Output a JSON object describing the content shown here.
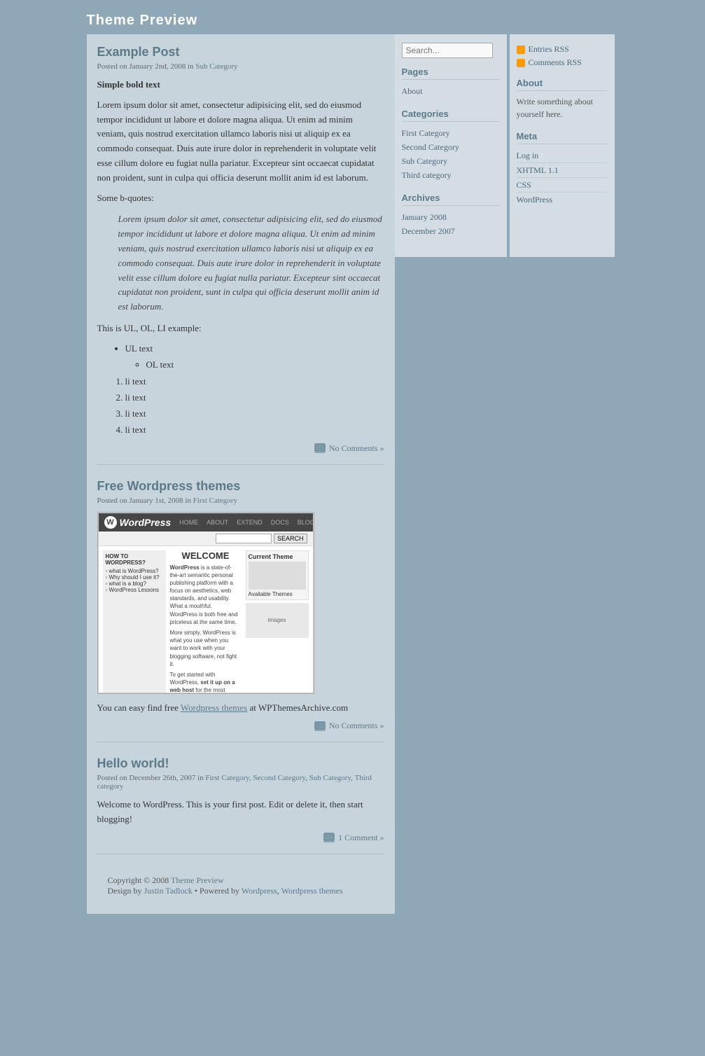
{
  "site": {
    "title": "Theme Preview"
  },
  "posts": [
    {
      "id": "post-1",
      "title": "Example Post",
      "meta": "Posted on January 2nd, 2008 in",
      "category": "Sub Category",
      "bold_heading": "Simple bold text",
      "lorem_paragraph": "Lorem ipsum dolor sit amet, consectetur adipisicing elit, sed do eiusmod tempor incididunt ut labore et dolore magna aliqua. Ut enim ad minim veniam, quis nostrud exercitation ullamco laboris nisi ut aliquip ex ea commodo consequat. Duis aute irure dolor in reprehenderit in voluptate velit esse cillum dolore eu fugiat nulla pariatur. Excepteur sint occaecat cupidatat non proident, sunt in culpa qui officia deserunt mollit anim id est laborum.",
      "bquotes_heading": "Some b-quotes:",
      "blockquote": "Lorem ipsum dolor sit amet, consectetur adipisicing elit, sed do eiusmod tempor incididunt ut labore et dolore magna aliqua. Ut enim ad minim veniam, quis nostrud exercitation ullamco laboris nisi ut aliquip ex ea commodo consequat. Duis aute irure dolor in reprehenderit in voluptate velit esse cillum dolore eu fugiat nulla pariatur. Excepteur sint occaecat cupidatat non proident, sunt in culpa qui officia deserunt mollit anim id est laborum.",
      "ul_heading": "This is UL, OL, LI example:",
      "ul_label": "UL text",
      "ol_label": "OL text",
      "li_items": [
        "li text",
        "li text",
        "li text",
        "li text"
      ],
      "comments": "No Comments »"
    },
    {
      "id": "post-2",
      "title": "Free Wordpress themes",
      "meta": "Posted on January 1st, 2008 in",
      "category": "First Category",
      "body_text_1": "You can easy find free",
      "link_text": "Wordpress themes",
      "body_text_2": "at WPThemesArchive.com",
      "comments": "No Comments »"
    },
    {
      "id": "post-3",
      "title": "Hello world!",
      "meta": "Posted on December 26th, 2007 in",
      "categories": [
        "First Category",
        "Second Category",
        "Sub Category",
        "Third category"
      ],
      "body_text": "Welcome to WordPress. This is your first post. Edit or delete it, then start blogging!",
      "comments": "1 Comment »"
    }
  ],
  "footer": {
    "copyright": "Copyright © 2008",
    "site_link": "Theme Preview",
    "design_by": "Design by",
    "designer": "Justin Tadlock",
    "powered_by": "Powered by",
    "wordpress": "Wordpress",
    "comma": ",",
    "wp_themes": "Wordpress themes"
  },
  "sidebar_left": {
    "search_placeholder": "Search...",
    "pages_heading": "Pages",
    "pages": [
      {
        "label": "About",
        "href": "#"
      }
    ],
    "categories_heading": "Categories",
    "categories": [
      {
        "label": "First Category"
      },
      {
        "label": "Second Category"
      },
      {
        "label": "Sub Category"
      },
      {
        "label": "Third category"
      }
    ],
    "archives_heading": "Archives",
    "archives": [
      {
        "label": "January 2008"
      },
      {
        "label": "December 2007"
      }
    ]
  },
  "sidebar_right": {
    "rss_entries": "Entries RSS",
    "rss_comments": "Comments RSS",
    "about_heading": "About",
    "about_text": "Write something about yourself here.",
    "meta_heading": "Meta",
    "meta_links": [
      {
        "label": "Log in"
      },
      {
        "label": "XHTML 1.1"
      },
      {
        "label": "CSS"
      },
      {
        "label": "WordPress"
      }
    ]
  }
}
